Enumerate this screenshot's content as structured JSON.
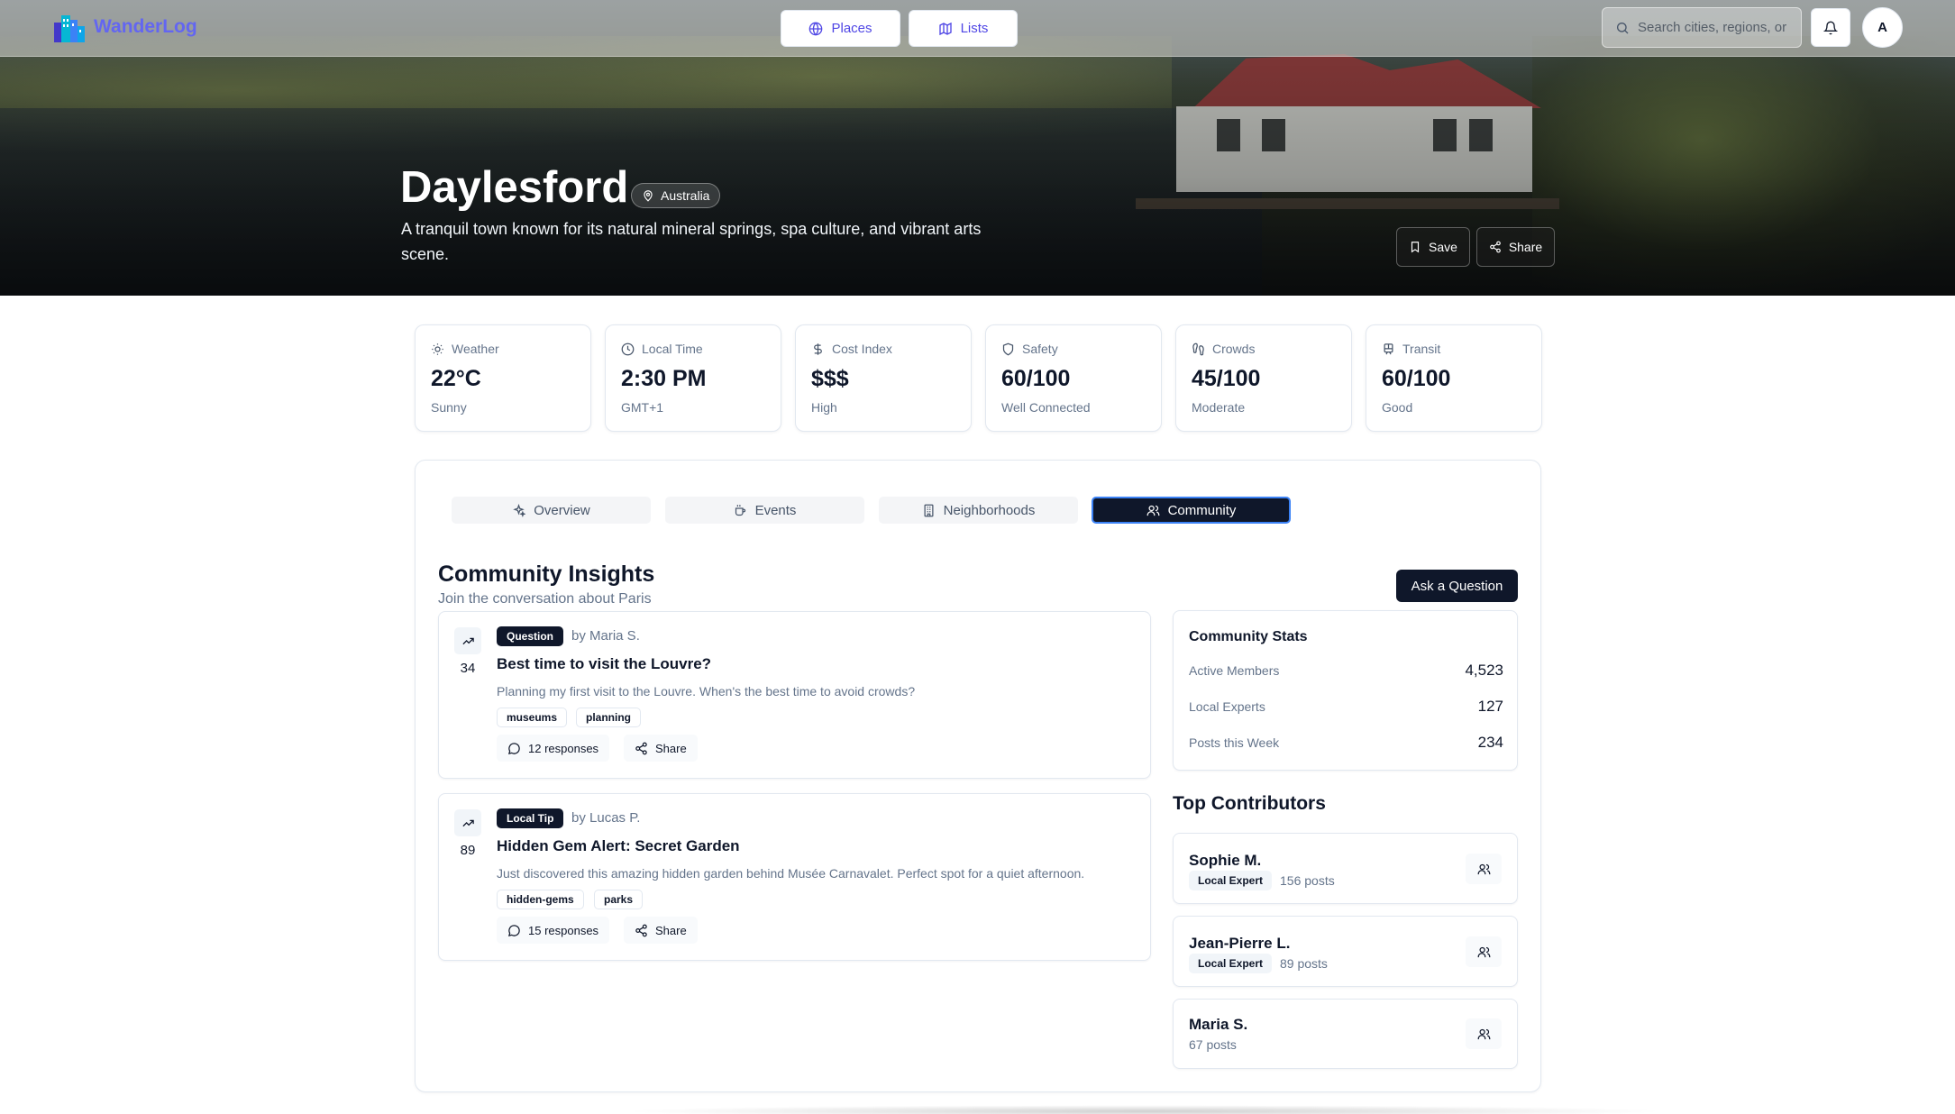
{
  "app": {
    "name": "WanderLog"
  },
  "nav": {
    "places_label": "Places",
    "lists_label": "Lists"
  },
  "search": {
    "placeholder": "Search cities, regions, or"
  },
  "user": {
    "avatar_initial": "A"
  },
  "destination": {
    "name": "Daylesford",
    "country": "Australia",
    "description": "A tranquil town known for its natural mineral springs, spa culture, and vibrant arts scene.",
    "save_label": "Save",
    "share_label": "Share"
  },
  "stats": [
    {
      "label": "Weather",
      "value": "22°C",
      "sub": "Sunny",
      "icon": "sun-icon"
    },
    {
      "label": "Local Time",
      "value": "2:30 PM",
      "sub": "GMT+1",
      "icon": "clock-icon"
    },
    {
      "label": "Cost Index",
      "value": "$$$",
      "sub": "High",
      "icon": "dollar-icon"
    },
    {
      "label": "Safety",
      "value": "60/100",
      "sub": "Well Connected",
      "icon": "shield-icon"
    },
    {
      "label": "Crowds",
      "value": "45/100",
      "sub": "Moderate",
      "icon": "footprints-icon"
    },
    {
      "label": "Transit",
      "value": "60/100",
      "sub": "Good",
      "icon": "train-icon"
    }
  ],
  "tabs": [
    {
      "label": "Overview",
      "icon": "sparkles-icon",
      "active": false
    },
    {
      "label": "Events",
      "icon": "coffee-icon",
      "active": false
    },
    {
      "label": "Neighborhoods",
      "icon": "building-icon",
      "active": false
    },
    {
      "label": "Community",
      "icon": "users-icon",
      "active": true
    }
  ],
  "community": {
    "title": "Community Insights",
    "subtitle": "Join the conversation about Paris",
    "ask_label": "Ask a Question",
    "posts": [
      {
        "votes": "34",
        "type": "Question",
        "author": "by Maria S.",
        "title": "Best time to visit the Louvre?",
        "body": "Planning my first visit to the Louvre. When's the best time to avoid crowds?",
        "tags": [
          "museums",
          "planning"
        ],
        "responses": "12 responses",
        "share_label": "Share"
      },
      {
        "votes": "89",
        "type": "Local Tip",
        "author": "by Lucas P.",
        "title": "Hidden Gem Alert: Secret Garden",
        "body": "Just discovered this amazing hidden garden behind Musée Carnavalet. Perfect spot for a quiet afternoon.",
        "tags": [
          "hidden-gems",
          "parks"
        ],
        "responses": "15 responses",
        "share_label": "Share"
      }
    ],
    "stats": {
      "title": "Community Stats",
      "rows": [
        {
          "label": "Active Members",
          "value": "4,523"
        },
        {
          "label": "Local Experts",
          "value": "127"
        },
        {
          "label": "Posts this Week",
          "value": "234"
        }
      ]
    },
    "contributors": {
      "title": "Top Contributors",
      "items": [
        {
          "name": "Sophie M.",
          "badge": "Local Expert",
          "posts": "156 posts"
        },
        {
          "name": "Jean-Pierre L.",
          "badge": "Local Expert",
          "posts": "89 posts"
        },
        {
          "name": "Maria S.",
          "badge": "",
          "posts": "67 posts"
        }
      ]
    }
  },
  "colors": {
    "brand": "#6366f1",
    "dark": "#0f172a",
    "muted": "#64748b",
    "active_tab_border": "#3b82f6"
  }
}
